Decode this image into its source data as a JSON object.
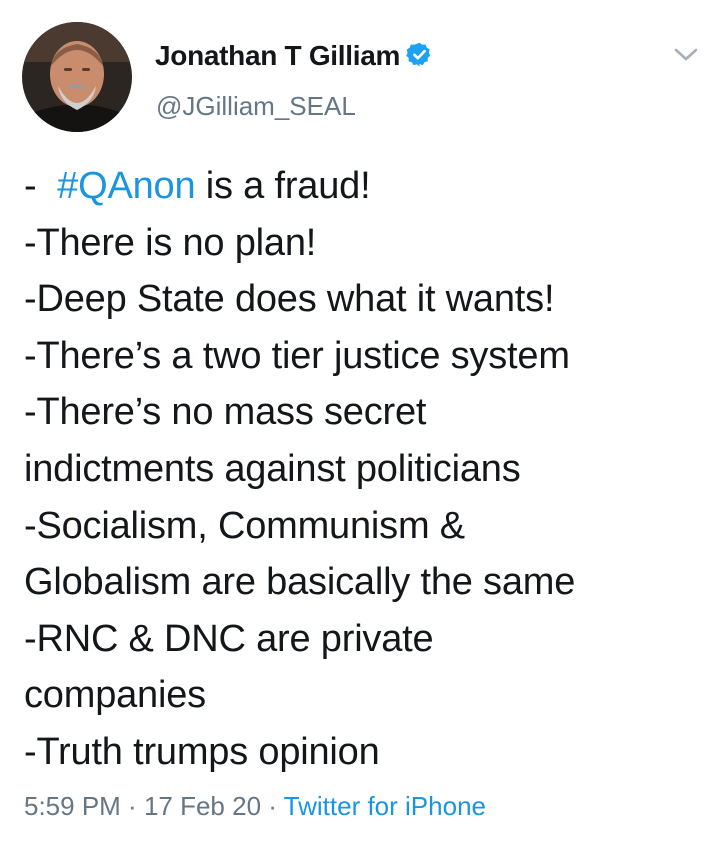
{
  "author": {
    "name": "Jonathan T Gilliam",
    "handle": "@JGilliam_SEAL",
    "verified": true,
    "avatar_icon": "profile-photo"
  },
  "menu": {
    "icon": "chevron-down-icon"
  },
  "tweet": {
    "first_line_prefix": "- ",
    "hashtag": "#QAnon",
    "first_line_suffix": " is a fraud!",
    "lines": [
      "-There is no plan!",
      "-Deep State does what it wants!",
      "-There’s a two tier justice system",
      "-There’s no mass secret",
      "indictments against politicians",
      "-Socialism, Communism &",
      "Globalism are basically the same",
      "-RNC & DNC are private",
      "companies",
      "-Truth trumps opinion"
    ]
  },
  "meta": {
    "time": "5:59 PM",
    "date": "17 Feb 20",
    "separator": " · ",
    "source": "Twitter for iPhone"
  },
  "colors": {
    "link": "#1b95e0",
    "secondary_text": "#657786",
    "primary_text": "#14171a",
    "verified_badge": "#1da1f2"
  }
}
